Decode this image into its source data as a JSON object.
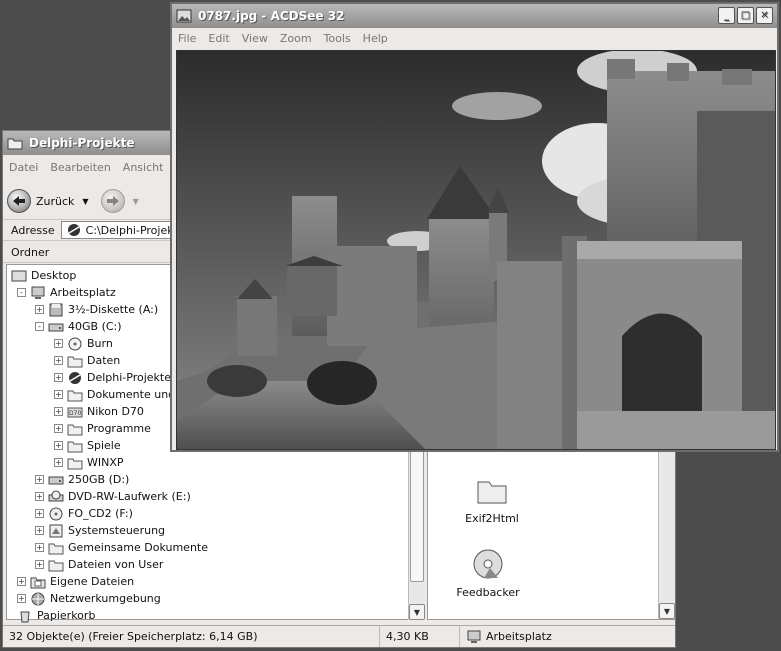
{
  "explorer": {
    "title": "Delphi-Projekte",
    "menu": [
      "Datei",
      "Bearbeiten",
      "Ansicht"
    ],
    "back_label": "Zurück",
    "address_label": "Adresse",
    "address_value": "C:\\Delphi-Projekte",
    "folders_header": "Ordner",
    "tree": [
      {
        "label": "Desktop",
        "icon": "desktop-icon",
        "level": 0,
        "expander": ""
      },
      {
        "label": "Arbeitsplatz",
        "icon": "computer-icon",
        "level": 1,
        "expander": "-"
      },
      {
        "label": "3½-Diskette (A:)",
        "icon": "floppy-icon",
        "level": 2,
        "expander": "+"
      },
      {
        "label": "40GB (C:)",
        "icon": "drive-icon",
        "level": 2,
        "expander": "-"
      },
      {
        "label": "Burn",
        "icon": "cd-folder-icon",
        "level": 3,
        "expander": "+"
      },
      {
        "label": "Daten",
        "icon": "folder-icon",
        "level": 3,
        "expander": "+"
      },
      {
        "label": "Delphi-Projekte",
        "icon": "delphi-folder-icon",
        "level": 3,
        "expander": "+"
      },
      {
        "label": "Dokumente und E",
        "icon": "folder-icon",
        "level": 3,
        "expander": "+"
      },
      {
        "label": "Nikon D70",
        "icon": "camera-folder-icon",
        "level": 3,
        "expander": "+"
      },
      {
        "label": "Programme",
        "icon": "folder-icon",
        "level": 3,
        "expander": "+"
      },
      {
        "label": "Spiele",
        "icon": "folder-icon",
        "level": 3,
        "expander": "+"
      },
      {
        "label": "WINXP",
        "icon": "folder-icon",
        "level": 3,
        "expander": "+"
      },
      {
        "label": "250GB (D:)",
        "icon": "drive-icon",
        "level": 2,
        "expander": "+"
      },
      {
        "label": "DVD-RW-Laufwerk (E:)",
        "icon": "dvd-icon",
        "level": 2,
        "expander": "+"
      },
      {
        "label": "FO_CD2 (F:)",
        "icon": "cd-icon",
        "level": 2,
        "expander": "+"
      },
      {
        "label": "Systemsteuerung",
        "icon": "control-panel-icon",
        "level": 2,
        "expander": "+"
      },
      {
        "label": "Gemeinsame Dokumente",
        "icon": "folder-icon",
        "level": 2,
        "expander": "+"
      },
      {
        "label": "Dateien von User",
        "icon": "folder-icon",
        "level": 2,
        "expander": "+"
      },
      {
        "label": "Eigene Dateien",
        "icon": "my-documents-icon",
        "level": 1,
        "expander": "+"
      },
      {
        "label": "Netzwerkumgebung",
        "icon": "network-icon",
        "level": 1,
        "expander": "+"
      },
      {
        "label": "Papierkorb",
        "icon": "recycle-bin-icon",
        "level": 1,
        "expander": ""
      }
    ],
    "files": [
      {
        "label": "Exif2Html",
        "icon": "folder-icon"
      },
      {
        "label": "Feedbacker",
        "icon": "cd-icon"
      }
    ],
    "status": {
      "objects": "32 Objekte(e) (Freier Speicherplatz: 6,14 GB)",
      "size": "4,30 KB",
      "location": "Arbeitsplatz"
    }
  },
  "acdsee": {
    "title": "0787.jpg - ACDSee 32",
    "menu": [
      "File",
      "Edit",
      "View",
      "Zoom",
      "Tools",
      "Help"
    ]
  }
}
